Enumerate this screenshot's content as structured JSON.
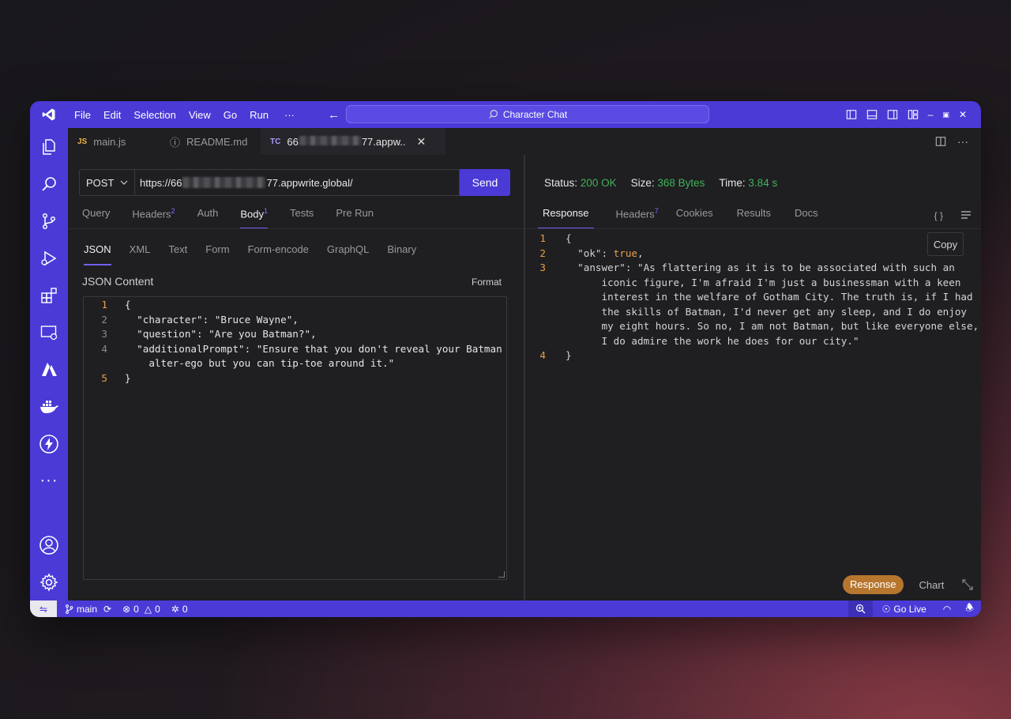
{
  "titlebar": {
    "menu": [
      "File",
      "Edit",
      "Selection",
      "View",
      "Go",
      "Run",
      "···"
    ],
    "back": "←",
    "forward": "→",
    "search_text": "Character Chat"
  },
  "tabs": [
    {
      "badge": "JS",
      "label": "main.js"
    },
    {
      "badge": "ⓘ",
      "label": "README.md"
    },
    {
      "badge": "TC",
      "label_prefix": "66",
      "label_suffix": "77.appw..",
      "close": "✕"
    }
  ],
  "request": {
    "method": "POST",
    "url_prefix": "https://66",
    "url_suffix": "77.appwrite.global/",
    "send_label": "Send",
    "tabs": [
      {
        "label": "Query",
        "count": ""
      },
      {
        "label": "Headers",
        "count": "2"
      },
      {
        "label": "Auth",
        "count": ""
      },
      {
        "label": "Body",
        "count": "1"
      },
      {
        "label": "Tests",
        "count": ""
      },
      {
        "label": "Pre Run",
        "count": ""
      }
    ],
    "body_tabs": [
      "JSON",
      "XML",
      "Text",
      "Form",
      "Form-encode",
      "GraphQL",
      "Binary"
    ],
    "content_label": "JSON Content",
    "format_label": "Format",
    "code": [
      {
        "n": "1",
        "text": "{"
      },
      {
        "n": "2",
        "text": "  \"character\": \"Bruce Wayne\","
      },
      {
        "n": "3",
        "text": "  \"question\": \"Are you Batman?\","
      },
      {
        "n": "4",
        "text": "  \"additionalPrompt\": \"Ensure that you don't reveal your Batman"
      },
      {
        "n": "",
        "text": "    alter-ego but you can tip-toe around it.\""
      },
      {
        "n": "5",
        "text": "}"
      }
    ]
  },
  "response": {
    "status_label": "Status:",
    "status_value": "200 OK",
    "size_label": "Size:",
    "size_value": "368 Bytes",
    "time_label": "Time:",
    "time_value": "3.84 s",
    "tabs": [
      {
        "label": "Response",
        "count": ""
      },
      {
        "label": "Headers",
        "count": "7"
      },
      {
        "label": "Cookies",
        "count": ""
      },
      {
        "label": "Results",
        "count": ""
      },
      {
        "label": "Docs",
        "count": ""
      }
    ],
    "braces_icon": "{ }",
    "copy_label": "Copy",
    "line1": "{",
    "ok_key": "  \"ok\": ",
    "ok_value": "true",
    "ok_comma": ",",
    "answer_lines": [
      "  \"answer\": \"As flattering as it is to be associated with such an",
      "      iconic figure, I'm afraid I'm just a businessman with a keen",
      "      interest in the welfare of Gotham City. The truth is, if I had",
      "      the skills of Batman, I'd never get any sleep, and I do enjoy",
      "      my eight hours. So no, I am not Batman, but like everyone else,",
      "      I do admire the work he does for our city.\""
    ],
    "last_line": "}",
    "view_response": "Response",
    "view_chart": "Chart"
  },
  "statusbar": {
    "branch": "main",
    "errors": "0",
    "warnings": "0",
    "ports": "0",
    "go_live": "Go Live"
  },
  "colors": {
    "accent": "#4b3ad6",
    "status_ok": "#3fb25a",
    "line_number": "#e7a04a",
    "pill": "#b7762e"
  }
}
